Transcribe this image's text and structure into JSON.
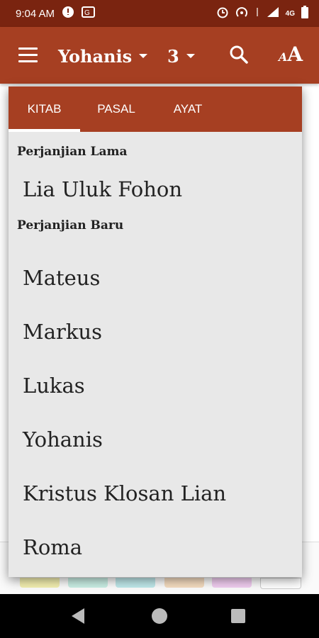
{
  "status_bar": {
    "time": "9:04 AM",
    "network": "4G",
    "icons": [
      "notification-icon",
      "translate-icon",
      "alarm-icon",
      "hotspot-icon",
      "wifi-icon",
      "signal-icon",
      "battery-icon"
    ]
  },
  "app_bar": {
    "book": "Yohanis",
    "chapter": "3",
    "icons": [
      "menu-icon",
      "search-icon",
      "font-size-icon"
    ]
  },
  "tabs": [
    {
      "label": "KITAB",
      "active": true
    },
    {
      "label": "PASAL",
      "active": false
    },
    {
      "label": "AYAT",
      "active": false
    }
  ],
  "sections": [
    {
      "heading": "Perjanjian Lama",
      "books": [
        "Lia Uluk Fohon"
      ]
    },
    {
      "heading": "Perjanjian Baru",
      "books": [
        "Mateus",
        "Markus",
        "Lukas",
        "Yohanis",
        "Kristus Klosan Lian",
        "Roma"
      ]
    }
  ],
  "colors": {
    "status_bar": "#7a2410",
    "primary": "#a63f22",
    "panel_bg": "#e8e8e8",
    "swatches": [
      "#f3efb0",
      "#c9eee4",
      "#bfe8ea",
      "#f5dcc0",
      "#f1cdf0",
      "#ffffff"
    ]
  },
  "navigation": {
    "icons": [
      "back-icon",
      "home-icon",
      "recent-apps-icon"
    ]
  }
}
